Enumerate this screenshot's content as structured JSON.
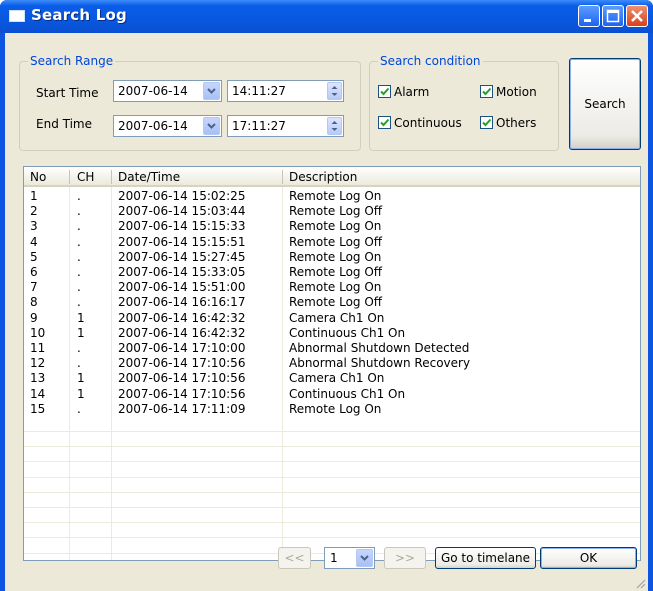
{
  "window": {
    "title": "Search Log"
  },
  "search_range": {
    "title": "Search Range",
    "start_label": "Start Time",
    "end_label": "End Time",
    "start_date": "2007-06-14",
    "start_time": "14:11:27",
    "end_date": "2007-06-14",
    "end_time": "17:11:27"
  },
  "search_condition": {
    "title": "Search condition",
    "alarm": "Alarm",
    "motion": "Motion",
    "continuous": "Continuous",
    "others": "Others",
    "alarm_checked": true,
    "motion_checked": true,
    "continuous_checked": true,
    "others_checked": true
  },
  "search_button": "Search",
  "table": {
    "headers": [
      "No",
      "CH",
      "Date/Time",
      "Description"
    ],
    "rows": [
      [
        "1",
        ".",
        "2007-06-14 15:02:25",
        "Remote Log On"
      ],
      [
        "2",
        ".",
        "2007-06-14 15:03:44",
        "Remote Log Off"
      ],
      [
        "3",
        ".",
        "2007-06-14 15:15:33",
        "Remote Log On"
      ],
      [
        "4",
        ".",
        "2007-06-14 15:15:51",
        "Remote Log Off"
      ],
      [
        "5",
        ".",
        "2007-06-14 15:27:45",
        "Remote Log On"
      ],
      [
        "6",
        ".",
        "2007-06-14 15:33:05",
        "Remote Log Off"
      ],
      [
        "7",
        ".",
        "2007-06-14 15:51:00",
        "Remote Log On"
      ],
      [
        "8",
        ".",
        "2007-06-14 16:16:17",
        "Remote Log Off"
      ],
      [
        "9",
        "1",
        "2007-06-14 16:42:32",
        "Camera Ch1 On"
      ],
      [
        "10",
        "1",
        "2007-06-14 16:42:32",
        "Continuous Ch1 On"
      ],
      [
        "11",
        ".",
        "2007-06-14 17:10:00",
        "Abnormal Shutdown Detected"
      ],
      [
        "12",
        ".",
        "2007-06-14 17:10:56",
        "Abnormal Shutdown Recovery"
      ],
      [
        "13",
        "1",
        "2007-06-14 17:10:56",
        "Camera Ch1 On"
      ],
      [
        "14",
        "1",
        "2007-06-14 17:10:56",
        "Continuous Ch1 On"
      ],
      [
        "15",
        ".",
        "2007-06-14 17:11:09",
        "Remote Log On"
      ]
    ]
  },
  "pager": {
    "prev": "<<",
    "page": "1",
    "next": ">>",
    "goto": "Go to timelane",
    "ok": "OK"
  }
}
